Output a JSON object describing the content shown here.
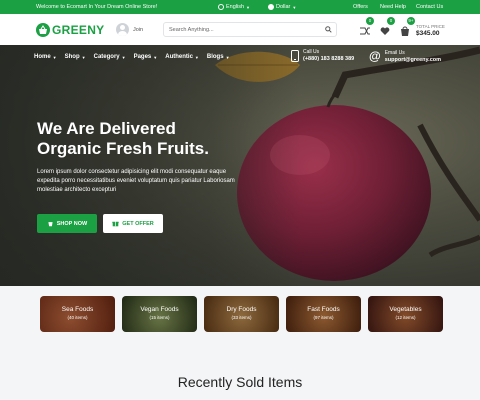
{
  "topbar": {
    "welcome": "Welcome to Ecomart In Your Dream Online Store!",
    "language": "English",
    "currency": "Dollar",
    "links": [
      "Offers",
      "Need Help",
      "Contact Us"
    ]
  },
  "header": {
    "logo": "GREENY",
    "join": "Join",
    "search_placeholder": "Search Anything...",
    "badges": {
      "compare": "0",
      "wishlist": "0",
      "cart": "9+"
    },
    "total_label": "TOTAL PRICE",
    "total_amount": "$345.00"
  },
  "nav": {
    "items": [
      "Home",
      "Shop",
      "Category",
      "Pages",
      "Authentic",
      "Blogs"
    ],
    "call_label": "Call Us",
    "call_value": "(+880) 183 8288 389",
    "email_label": "Email Us",
    "email_value": "support@greeny.com"
  },
  "hero": {
    "title_line1": "We Are Delivered",
    "title_line2": "Organic Fresh Fruits.",
    "text": "Lorem ipsum dolor consectetur adipisicing elit modi consequatur eaque expedita porro necessitatibus eveniet voluptatum quis pariatur Laboriosam molestiae architecto excepturi",
    "shop_button": "SHOP NOW",
    "offer_button": "GET OFFER"
  },
  "categories": [
    {
      "name": "Sea Foods",
      "count": "(40 items)",
      "color": "#b5512e"
    },
    {
      "name": "Vegan Foods",
      "count": "(15 items)",
      "color": "#5f7a3b"
    },
    {
      "name": "Dry Foods",
      "count": "(33 items)",
      "color": "#b07a3e"
    },
    {
      "name": "Fast Foods",
      "count": "(97 items)",
      "color": "#a55a2a"
    },
    {
      "name": "Vegetables",
      "count": "(12 items)",
      "color": "#8a3f31"
    }
  ],
  "section": {
    "title": "Recently Sold Items"
  },
  "colors": {
    "brand": "#1ba043"
  }
}
